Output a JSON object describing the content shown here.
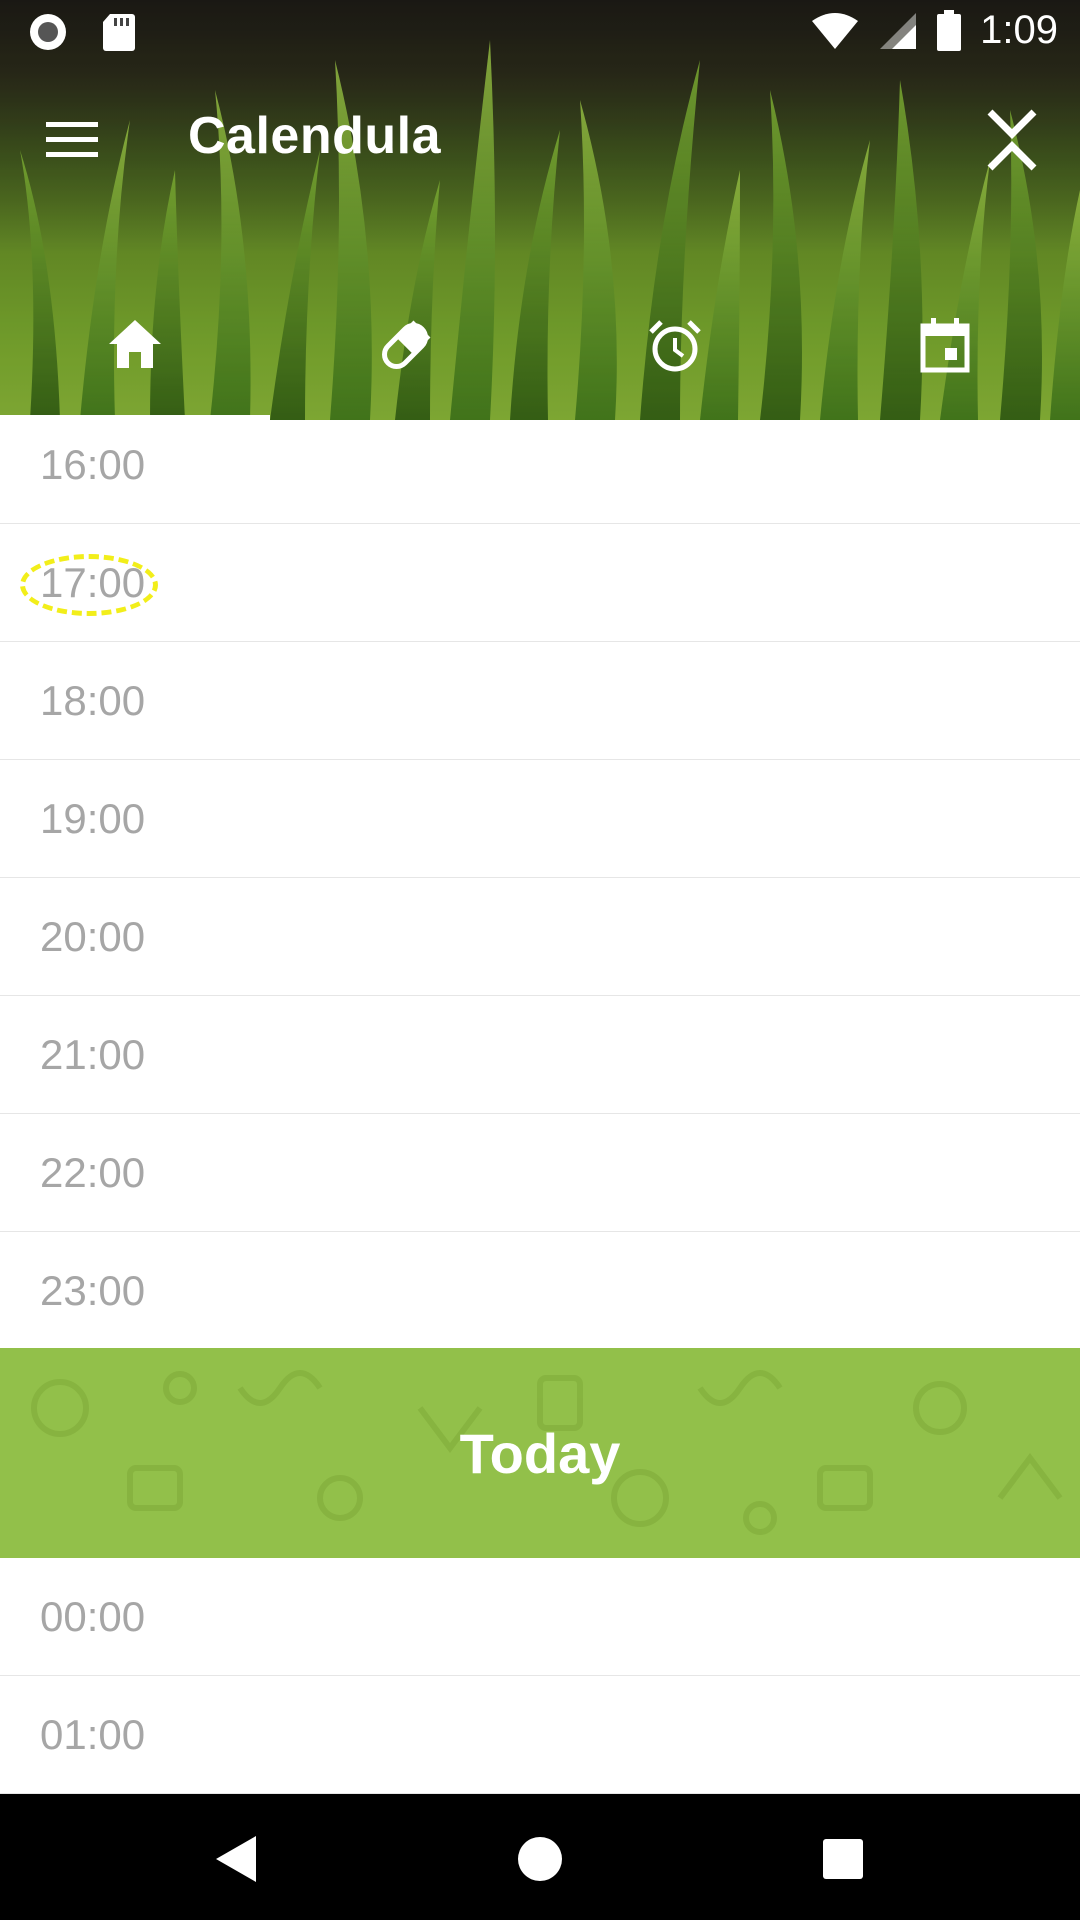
{
  "status_bar": {
    "time": "1:09",
    "icons": [
      "record-icon",
      "sd-card-icon",
      "wifi-icon",
      "signal-icon",
      "battery-icon"
    ]
  },
  "toolbar": {
    "title": "Calendula",
    "menu_icon": "hamburger-menu-icon",
    "collapse_icon": "collapse-expand-icon"
  },
  "tabs": [
    {
      "icon": "home-icon",
      "active": true
    },
    {
      "icon": "pill-icon",
      "active": false
    },
    {
      "icon": "alarm-clock-icon",
      "active": false
    },
    {
      "icon": "calendar-icon",
      "active": false
    }
  ],
  "timeline": {
    "hours_before": [
      "16:00",
      "17:00",
      "18:00",
      "19:00",
      "20:00",
      "21:00",
      "22:00",
      "23:00"
    ],
    "divider_label": "Today",
    "hours_after": [
      "00:00",
      "01:00"
    ],
    "highlighted_hour": "17:00"
  },
  "colors": {
    "accent_green": "#92c04a",
    "hour_text": "#a6a6a6",
    "highlight": "#f2ee1a"
  },
  "nav_bar": {
    "buttons": [
      "back-icon",
      "home-circle-icon",
      "recents-icon"
    ]
  }
}
